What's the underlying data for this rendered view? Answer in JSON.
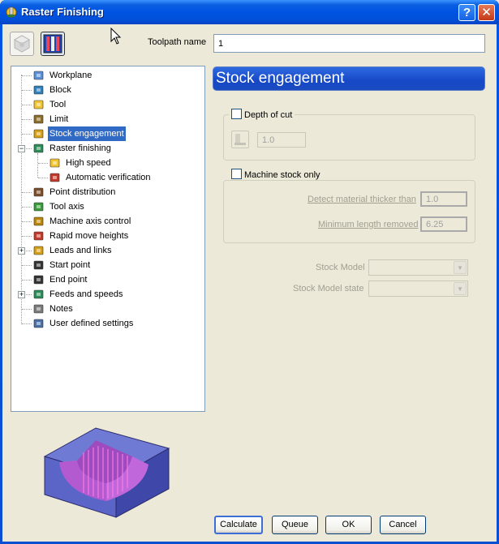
{
  "window": {
    "title": "Raster Finishing",
    "help_label": "?",
    "close_label": "✕"
  },
  "toolbar": {
    "icons": [
      "strategy-icon-inactive",
      "raster-finishing-icon"
    ]
  },
  "toolpath_name": {
    "label": "Toolpath name",
    "value": "1"
  },
  "tree": {
    "items": [
      {
        "label": "Workplane",
        "icon": "workplane-icon"
      },
      {
        "label": "Block",
        "icon": "block-icon"
      },
      {
        "label": "Tool",
        "icon": "tool-icon"
      },
      {
        "label": "Limit",
        "icon": "limit-icon"
      },
      {
        "label": "Stock engagement",
        "icon": "stock-engagement-icon",
        "selected": true
      },
      {
        "label": "Raster finishing",
        "icon": "raster-finishing-icon",
        "expanded": true
      },
      {
        "label": "High speed",
        "icon": "high-speed-icon"
      },
      {
        "label": "Automatic verification",
        "icon": "automatic-verification-icon"
      },
      {
        "label": "Point distribution",
        "icon": "point-distribution-icon"
      },
      {
        "label": "Tool axis",
        "icon": "tool-axis-icon"
      },
      {
        "label": "Machine axis control",
        "icon": "machine-axis-control-icon"
      },
      {
        "label": "Rapid move heights",
        "icon": "rapid-move-heights-icon"
      },
      {
        "label": "Leads and links",
        "icon": "leads-and-links-icon",
        "collapsed": true
      },
      {
        "label": "Start point",
        "icon": "start-point-icon"
      },
      {
        "label": "End point",
        "icon": "end-point-icon"
      },
      {
        "label": "Feeds and speeds",
        "icon": "feeds-and-speeds-icon",
        "collapsed": true
      },
      {
        "label": "Notes",
        "icon": "notes-icon"
      },
      {
        "label": "User defined settings",
        "icon": "user-defined-settings-icon"
      }
    ]
  },
  "page": {
    "title": "Stock engagement",
    "depth_of_cut": {
      "label": "Depth of cut",
      "checked": false,
      "value": "1.0"
    },
    "machine_stock_only": {
      "label": "Machine stock only",
      "checked": false,
      "detect_label": "Detect material thicker than",
      "detect_value": "1.0",
      "min_length_label": "Minimum length removed",
      "min_length_value": "6.25"
    },
    "stock_model_label": "Stock Model",
    "stock_model_value": "",
    "stock_model_state_label": "Stock Model state",
    "stock_model_state_value": ""
  },
  "buttons": {
    "calculate": "Calculate",
    "queue": "Queue",
    "ok": "OK",
    "cancel": "Cancel"
  },
  "colors": {
    "title_bar": "#0054e3",
    "header_blue": "#1748c7",
    "selection": "#316ac5"
  }
}
